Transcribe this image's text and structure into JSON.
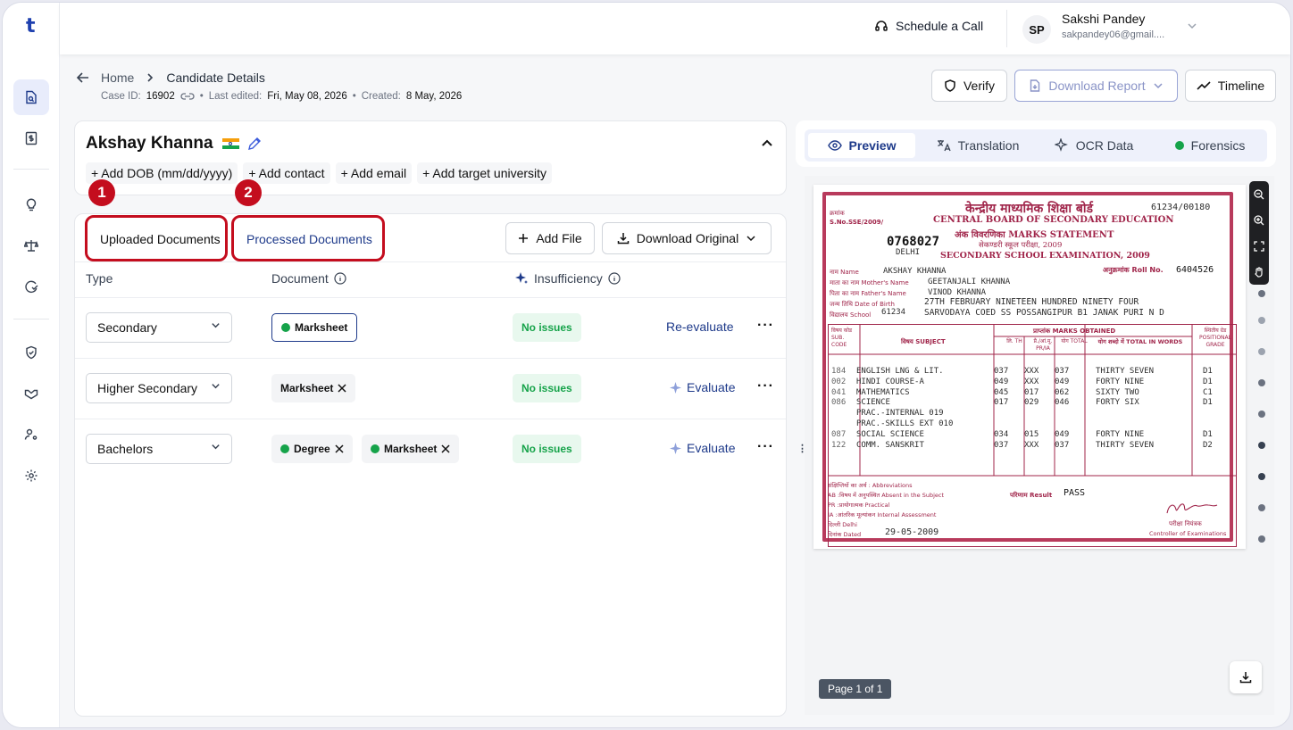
{
  "app": {
    "logo": "t"
  },
  "header": {
    "schedule": "Schedule a Call",
    "user": {
      "initials": "SP",
      "name": "Sakshi Pandey",
      "email": "sakpandey06@gmail...."
    }
  },
  "breadcrumb": {
    "home": "Home",
    "current": "Candidate Details"
  },
  "case": {
    "id_label": "Case ID:",
    "id": "16902",
    "edited_label": "Last edited:",
    "edited": "Fri, May 08, 2026",
    "created_label": "Created:",
    "created": "8 May, 2026"
  },
  "toolbar": {
    "verify": "Verify",
    "download_report": "Download Report",
    "timeline": "Timeline"
  },
  "candidate": {
    "name": "Akshay Khanna",
    "actions": [
      "Add DOB (mm/dd/yyyy)",
      "Add contact",
      "Add email",
      "Add target university"
    ]
  },
  "annotations": {
    "one": "1",
    "two": "2"
  },
  "docs": {
    "tab_uploaded": "Uploaded Documents",
    "tab_processed": "Processed Documents",
    "add_file": "Add File",
    "download_original": "Download Original",
    "col_type": "Type",
    "col_document": "Document",
    "col_insufficiency": "Insufficiency",
    "rows": [
      {
        "type": "Secondary",
        "chips": [
          "Marksheet"
        ],
        "status": "No issues",
        "action": "Re-evaluate"
      },
      {
        "type": "Higher Secondary",
        "chips": [
          "Marksheet"
        ],
        "status": "No issues",
        "action": "Evaluate"
      },
      {
        "type": "Bachelors",
        "chips": [
          "Degree",
          "Marksheet"
        ],
        "status": "No issues",
        "action": "Evaluate"
      }
    ]
  },
  "preview": {
    "tabs": [
      "Preview",
      "Translation",
      "OCR Data",
      "Forensics"
    ],
    "page": "Page 1 of 1"
  },
  "marksheet": {
    "serial_label": "क्रमांक",
    "serial_label2": "S.No.SSE/2009/",
    "serial": "0768027",
    "city_top": "DELHI",
    "board_hi": "केन्द्रीय माध्यमिक शिक्षा बोर्ड",
    "board_en": "CENTRAL BOARD OF SECONDARY EDUCATION",
    "stmt_hi": "अंक विवरणिका",
    "stmt_en": "MARKS STATEMENT",
    "exam_hi": "सेकण्डरी स्कूल परीक्षा, 2009",
    "exam_en": "SECONDARY SCHOOL EXAMINATION, 2009",
    "ref": "61234/00180",
    "roll_label": "अनुक्रमांक Roll No.",
    "roll": "6404526",
    "name_label": "नाम Name",
    "name": "AKSHAY KHANNA",
    "mother_label": "माता का नाम Mother's Name",
    "mother": "GEETANJALI KHANNA",
    "father_label": "पिता का नाम Father's Name",
    "father": "VINOD KHANNA",
    "dob_label": "जन्म तिथि Date of Birth",
    "dob": "27TH FEBRUARY NINETEEN HUNDRED NINETY FOUR",
    "school_label": "विद्यालय School",
    "school_code": "61234",
    "school": "SARVODAYA COED SS POSSANGIPUR B1 JANAK PURI N D",
    "hdr_code": "विषय कोड SUB. CODE",
    "hdr_subject": "विषय SUBJECT",
    "hdr_marks": "प्राप्तांक MARKS OBTAINED",
    "hdr_th": "लि. TH",
    "hdr_pr": "प्रै./आं.मू. PR/IA",
    "hdr_total": "योग TOTAL",
    "hdr_words": "योग शब्दो में TOTAL IN WORDS",
    "hdr_grade": "स्थितीय ग्रेड POSITIONAL GRADE",
    "subjects": [
      {
        "code": "184",
        "name": "ENGLISH LNG & LIT.",
        "th": "037",
        "pr": "XXX",
        "total": "037",
        "words": "THIRTY SEVEN",
        "grade": "D1"
      },
      {
        "code": "002",
        "name": "HINDI COURSE-A",
        "th": "049",
        "pr": "XXX",
        "total": "049",
        "words": "FORTY NINE",
        "grade": "D1"
      },
      {
        "code": "041",
        "name": "MATHEMATICS",
        "th": "045",
        "pr": "017",
        "total": "062",
        "words": "SIXTY TWO",
        "grade": "C1"
      },
      {
        "code": "086",
        "name": "SCIENCE",
        "th": "017",
        "pr": "029",
        "total": "046",
        "words": "FORTY SIX",
        "grade": "D1"
      },
      {
        "code": "",
        "name": "PRAC.-INTERNAL    019",
        "th": "",
        "pr": "",
        "total": "",
        "words": "",
        "grade": ""
      },
      {
        "code": "",
        "name": "PRAC.-SKILLS EXT 010",
        "th": "",
        "pr": "",
        "total": "",
        "words": "",
        "grade": ""
      },
      {
        "code": "087",
        "name": "SOCIAL SCIENCE",
        "th": "034",
        "pr": "015",
        "total": "049",
        "words": "FORTY NINE",
        "grade": "D1"
      },
      {
        "code": "122",
        "name": "COMM. SANSKRIT",
        "th": "037",
        "pr": "XXX",
        "total": "037",
        "words": "THIRTY SEVEN",
        "grade": "D2"
      }
    ],
    "abbr_title": "संक्षिप्तियों का अर्थ : Abbreviations",
    "abbr_ab": "AB :विषय में अनुपस्थित Absent in the Subject",
    "abbr_pr": "PR :प्रायोगात्मक  Practical",
    "abbr_ia": "IA  :आंतरिक मूल्यांकन  Internal Assessment",
    "place": "दिल्ली Delhi",
    "dated_label": "दिनांक Dated",
    "dated": "29-05-2009",
    "result_label": "परिणाम Result",
    "result": "PASS",
    "controller_hi": "परीक्षा नियंत्रक",
    "controller_en": "Controller of Examinations"
  }
}
